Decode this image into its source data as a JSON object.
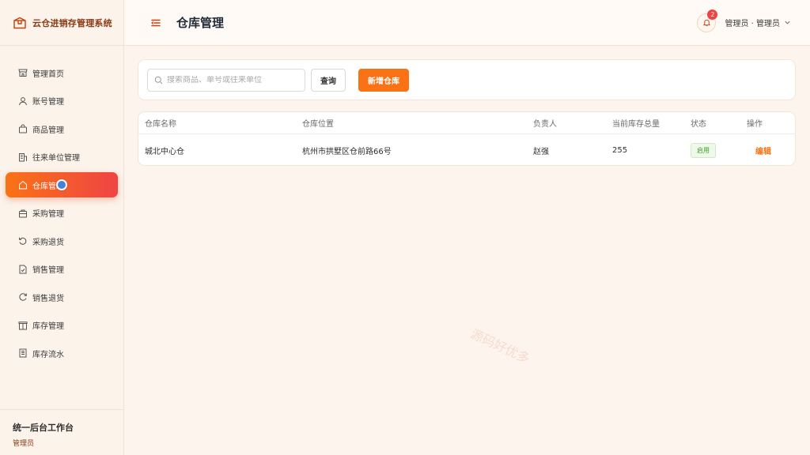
{
  "app": {
    "title": "云仓进销存管理系统"
  },
  "sidebar": {
    "items": [
      {
        "label": "管理首页",
        "icon": "storefront-icon"
      },
      {
        "label": "账号管理",
        "icon": "user-icon"
      },
      {
        "label": "商品管理",
        "icon": "shopping-bag-icon"
      },
      {
        "label": "往来单位管理",
        "icon": "building-icon"
      },
      {
        "label": "仓库管理",
        "icon": "house-icon",
        "active": true
      },
      {
        "label": "采购管理",
        "icon": "briefcase-icon"
      },
      {
        "label": "采购退货",
        "icon": "undo-icon"
      },
      {
        "label": "销售管理",
        "icon": "document-check-icon"
      },
      {
        "label": "销售退货",
        "icon": "refresh-icon"
      },
      {
        "label": "库存管理",
        "icon": "package-icon"
      },
      {
        "label": "库存流水",
        "icon": "list-icon"
      }
    ],
    "footer": {
      "title": "统一后台工作台",
      "subtitle": "管理员"
    }
  },
  "header": {
    "title": "仓库管理",
    "notification_count": "2",
    "user_label": "管理员 · 管理员"
  },
  "toolbar": {
    "search_placeholder": "搜索商品、单号或往来单位",
    "query_label": "查询",
    "add_label": "新增仓库"
  },
  "table": {
    "columns": [
      "仓库名称",
      "仓库位置",
      "负责人",
      "当前库存总量",
      "状态",
      "操作"
    ],
    "rows": [
      {
        "name": "城北中心仓",
        "location": "杭州市拱墅区仓前路66号",
        "manager": "赵强",
        "stock": "255",
        "status": "启用",
        "action": "编辑"
      }
    ]
  },
  "watermark": "源码好优多",
  "colors": {
    "accent": "#f97316",
    "accent_end": "#ef4444",
    "brand_text": "#8a3a14",
    "status_ok": "#3f9a2c"
  }
}
